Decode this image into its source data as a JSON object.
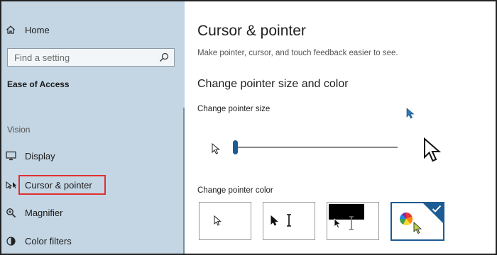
{
  "sidebar": {
    "home_label": "Home",
    "search_placeholder": "Find a setting",
    "section_title": "Ease of Access",
    "group_label": "Vision",
    "items": [
      {
        "label": "Display",
        "icon": "display-icon"
      },
      {
        "label": "Cursor & pointer",
        "icon": "cursor-pointer-icon",
        "selected": true
      },
      {
        "label": "Magnifier",
        "icon": "magnifier-icon"
      },
      {
        "label": "Color filters",
        "icon": "color-filters-icon"
      }
    ]
  },
  "main": {
    "title": "Cursor & pointer",
    "description": "Make pointer, cursor, and touch feedback easier to see.",
    "subsection_title": "Change pointer size and color",
    "pointer_size": {
      "label": "Change pointer size",
      "value_fraction": 0.0
    },
    "pointer_color": {
      "label": "Change pointer color",
      "options": [
        {
          "name": "white",
          "selected": false
        },
        {
          "name": "black",
          "selected": false
        },
        {
          "name": "inverted",
          "selected": false
        },
        {
          "name": "custom",
          "selected": true
        }
      ]
    }
  },
  "colors": {
    "accent": "#1c5b93",
    "sidebar_bg": "#c4d6e4",
    "highlight_box": "#e0302f",
    "preview_cursor": "#2a7bbd",
    "custom_cursor": "#b8d64a"
  }
}
